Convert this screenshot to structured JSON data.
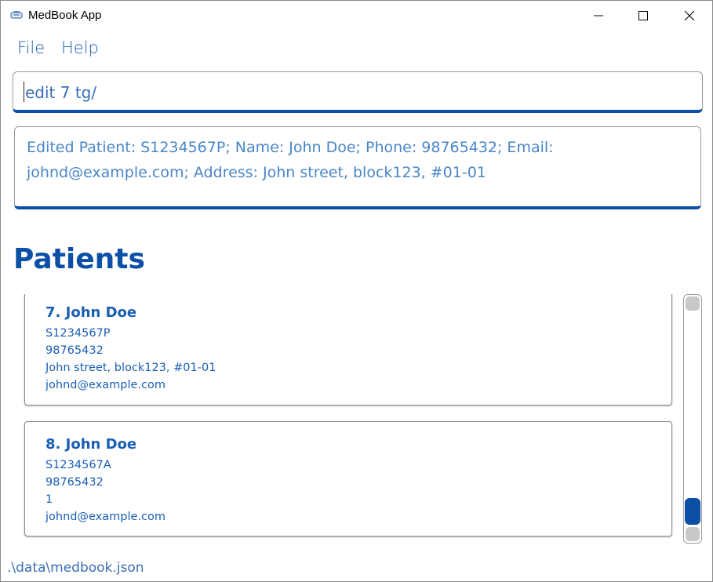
{
  "window": {
    "title": "MedBook App"
  },
  "menu": {
    "items": [
      {
        "label": "File"
      },
      {
        "label": "Help"
      }
    ]
  },
  "command": {
    "value": "edit 7 tg/"
  },
  "result": {
    "text": "Edited Patient: S1234567P; Name: John Doe; Phone: 98765432; Email: johnd@example.com; Address: John street, block123, #01-01"
  },
  "patients": {
    "title": "Patients",
    "list": [
      {
        "heading": "7.  John Doe",
        "nric": "S1234567P",
        "phone": "98765432",
        "address": "John street, block123, #01-01",
        "email": "johnd@example.com"
      },
      {
        "heading": "8.  John Doe",
        "nric": "S1234567A",
        "phone": "98765432",
        "address": "1",
        "email": "johnd@example.com"
      }
    ]
  },
  "status": {
    "file_path": ".\\data\\medbook.json"
  },
  "colors": {
    "accent": "#0b4fa6",
    "text": "#1a5fb4"
  },
  "icons": {
    "app": "medbook-app-icon",
    "minimize": "minimize-icon",
    "maximize": "maximize-icon",
    "close": "close-icon"
  }
}
